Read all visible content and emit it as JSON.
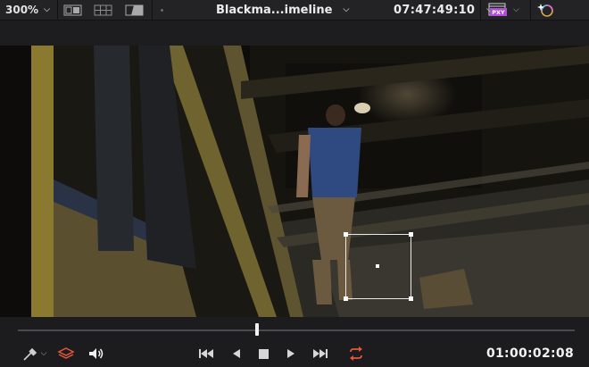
{
  "topbar": {
    "zoom_label": "300%",
    "timeline_title": "Blackma...imeline",
    "timecode": "07:47:49:10",
    "proxy_badge": "PXY"
  },
  "controls": {
    "timecode": "01:00:02:08",
    "playhead_position_fraction": 0.43
  },
  "icons": {
    "dual_view": "dual-view-icon",
    "grid": "grid-icon",
    "wipe": "wipe-icon",
    "effects": "fx-icon",
    "picker": "color-picker-icon",
    "layers": "layers-icon",
    "audio": "speaker-icon",
    "first": "skip-to-start-icon",
    "prev": "step-back-icon",
    "stop": "stop-icon",
    "play": "play-icon",
    "last": "skip-to-end-icon",
    "loop": "loop-icon"
  },
  "colors": {
    "accent_red": "#e8553c",
    "proxy_purple": "#b04dd8",
    "background": "#1c1c1e"
  }
}
